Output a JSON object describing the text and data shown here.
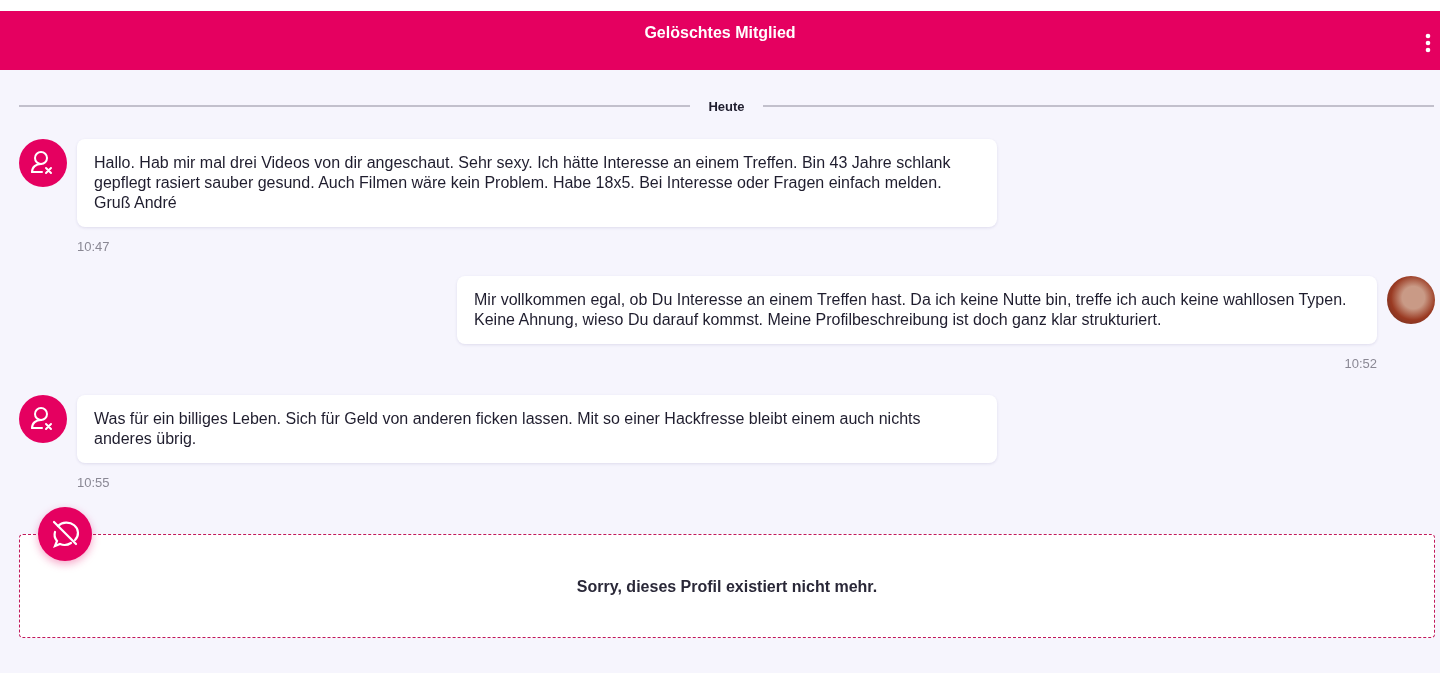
{
  "header": {
    "title": "Gelöschtes Mitglied"
  },
  "day_divider": {
    "label": "Heute"
  },
  "messages": [
    {
      "kind": "incoming",
      "text": "Hallo. Hab mir mal drei Videos von dir angeschaut. Sehr sexy. Ich hätte Interesse an einem Treffen. Bin 43 Jahre schlank gepflegt rasiert sauber gesund. Auch Filmen wäre kein Problem. Habe 18x5. Bei Interesse oder Fragen einfach melden. Gruß André",
      "time": "10:47"
    },
    {
      "kind": "outgoing",
      "text": "Mir vollkommen egal, ob Du Interesse an einem Treffen hast. Da ich keine Nutte bin, treffe ich auch keine wahllosen Typen. Keine Ahnung, wieso Du darauf kommst. Meine Profilbeschreibung ist doch ganz klar strukturiert.",
      "time": "10:52"
    },
    {
      "kind": "incoming",
      "text": "Was für ein billiges Leben. Sich für Geld von anderen ficken lassen.  Mit so einer Hackfresse bleibt einem auch nichts anderes übrig.",
      "time": "10:55"
    }
  ],
  "notice": {
    "text": "Sorry, dieses Profil existiert nicht mehr."
  }
}
